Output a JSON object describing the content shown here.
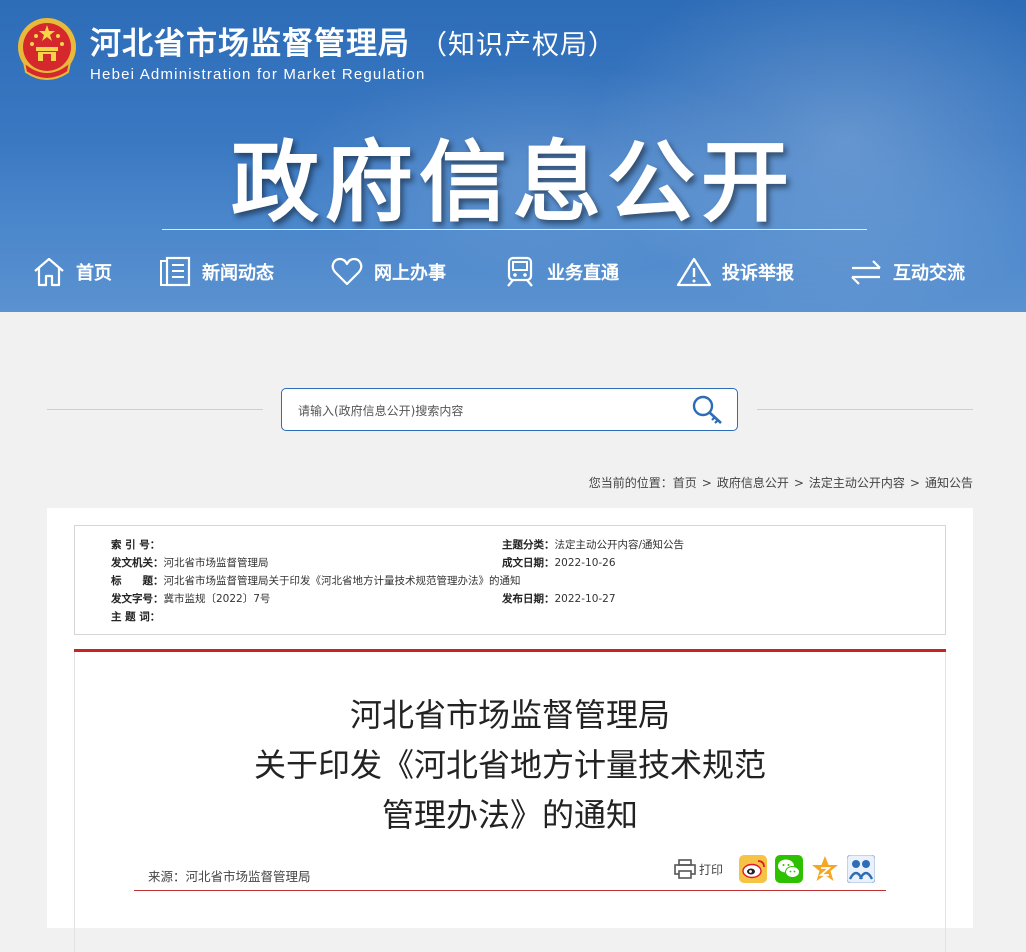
{
  "header": {
    "title": "河北省市场监督管理局",
    "title_sub": "（知识产权局）",
    "title_en": "Hebei Administration for Market Regulation",
    "banner": "政府信息公开"
  },
  "nav": [
    {
      "label": "首页",
      "icon": "home-icon"
    },
    {
      "label": "新闻动态",
      "icon": "document-icon"
    },
    {
      "label": "网上办事",
      "icon": "heart-icon"
    },
    {
      "label": "业务直通",
      "icon": "train-icon"
    },
    {
      "label": "投诉举报",
      "icon": "warning-icon"
    },
    {
      "label": "互动交流",
      "icon": "exchange-icon"
    }
  ],
  "search": {
    "placeholder": "请输入(政府信息公开)搜索内容",
    "button_icon": "key-search-icon"
  },
  "breadcrumb": {
    "prefix": "您当前的位置：",
    "items": [
      "首页",
      "政府信息公开",
      "法定主动公开内容",
      "通知公告"
    ],
    "separator": ">"
  },
  "meta": {
    "index_label": "索 引 号：",
    "index_value": "",
    "issuer_label": "发文机关：",
    "issuer_value": "河北省市场监督管理局",
    "title_label": "标　　题：",
    "title_value": "河北省市场监督管理局关于印发《河北省地方计量技术规范管理办法》的通知",
    "docno_label": "发文字号：",
    "docno_value": "冀市监规〔2022〕7号",
    "keywords_label": "主 题 词：",
    "keywords_value": "",
    "category_label": "主题分类：",
    "category_value": "法定主动公开内容/通知公告",
    "created_label": "成文日期：",
    "created_value": "2022-10-26",
    "published_label": "发布日期：",
    "published_value": "2022-10-27"
  },
  "article": {
    "title_line1": "河北省市场监督管理局",
    "title_line2": "关于印发《河北省地方计量技术规范",
    "title_line3": "管理办法》的通知",
    "source": "来源：河北省市场监督管理局",
    "print_label": "打印"
  },
  "share": [
    {
      "icon": "weibo-icon",
      "color": "#e6162d"
    },
    {
      "icon": "wechat-icon",
      "color": "#2dc100"
    },
    {
      "icon": "qzone-icon",
      "color": "#f5a623"
    },
    {
      "icon": "renren-icon",
      "color": "#2d6cb7"
    }
  ],
  "colors": {
    "header_blue": "#2d6cb7",
    "accent_red": "#c92424"
  }
}
